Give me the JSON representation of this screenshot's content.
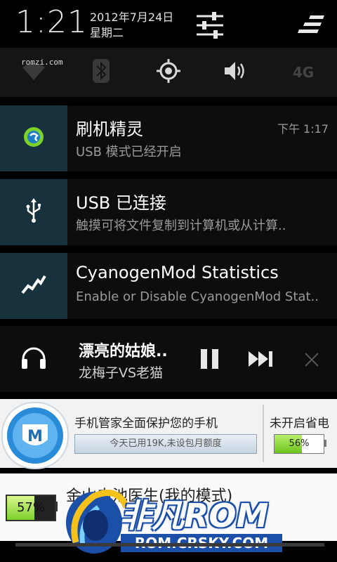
{
  "status": {
    "time": "1:21",
    "date": "2012年7月24日",
    "weekday": "星期二"
  },
  "toggles": {
    "watermark": "romzi.com",
    "network_label": "4G",
    "items": [
      "wifi-icon",
      "bluetooth-icon",
      "gps-icon",
      "sound-icon",
      "network-4g"
    ]
  },
  "notifications": [
    {
      "title": "刷机精灵",
      "subtitle": "USB 模式已经开启",
      "time": "下午 1:17",
      "icon": "shuaji-app-icon"
    },
    {
      "title": "USB 已连接",
      "subtitle": "触摸可将文件复制到计算机或从计算..",
      "time": "",
      "icon": "usb-icon"
    },
    {
      "title": "CyanogenMod Statistics",
      "subtitle": "Enable or Disable CyanogenMod Stat..",
      "time": "",
      "icon": "stats-icon"
    }
  ],
  "music": {
    "title": "漂亮的姑娘..",
    "artist": "龙梅子VS老猫"
  },
  "ad": {
    "headline": "手机管家全面保护您的手机",
    "usage": "今天已用19K,未设包月额度",
    "power_label": "未开启省电",
    "battery_percent_text": "56%",
    "battery_level": 0.56
  },
  "battery_doctor": {
    "title": "金山电池医生(我的模式)",
    "percent_text": "57%",
    "level": 0.57
  },
  "watermark": {
    "logo_text": "非凡ROM",
    "url": "ROM.CRSKY.COM"
  },
  "colors": {
    "icon_bg": "#17323d",
    "accent_green": "#7cd12a"
  }
}
